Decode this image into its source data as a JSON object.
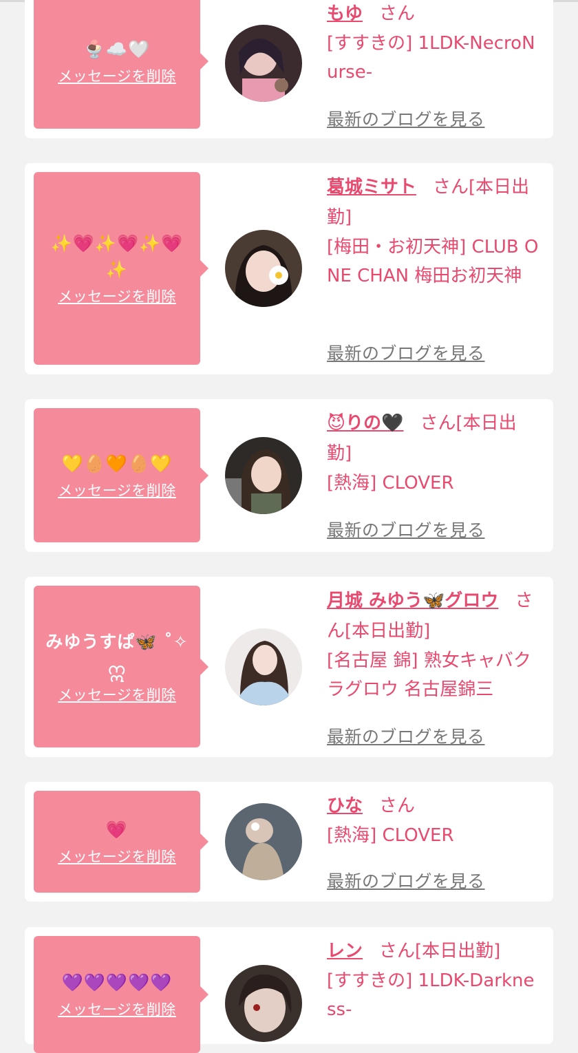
{
  "delete_label": "メッセージを削除",
  "blog_label": "最新のブログを見る",
  "san_label": "さん",
  "colors": {
    "accent": "#e8496f",
    "bubble": "#f48a9a",
    "background": "#f2f2f2"
  },
  "cards": [
    {
      "message": "🍨☁️🤍",
      "name": "もゆ",
      "san": "さん",
      "shop": "[すすきの] 1LDK-NecroNurse-"
    },
    {
      "message": "✨💗✨💗✨💗✨",
      "name": "葛城ミサト",
      "san": "さん[本日出勤]",
      "shop": "[梅田・お初天神] CLUB ONE CHAN 梅田お初天神"
    },
    {
      "message": "💛🥚🧡🥚💛",
      "name": "😈りの🖤",
      "san": "さん[本日出勤]",
      "shop": "[熱海] CLOVER"
    },
    {
      "message": "みゆうすぱ🦋 ˚✧ဣ",
      "name": "月城 みゆう🦋グロウ",
      "san": "さん[本日出勤]",
      "shop": "[名古屋 錦] 熟女キャバクラグロウ 名古屋錦三"
    },
    {
      "message": "💗",
      "name": "ひな",
      "san": "さん",
      "shop": "[熱海] CLOVER"
    },
    {
      "message": "💜💜💜💜💜",
      "name": "レン",
      "san": "さん[本日出勤]",
      "shop": "[すすきの] 1LDK-Darkness-"
    }
  ]
}
